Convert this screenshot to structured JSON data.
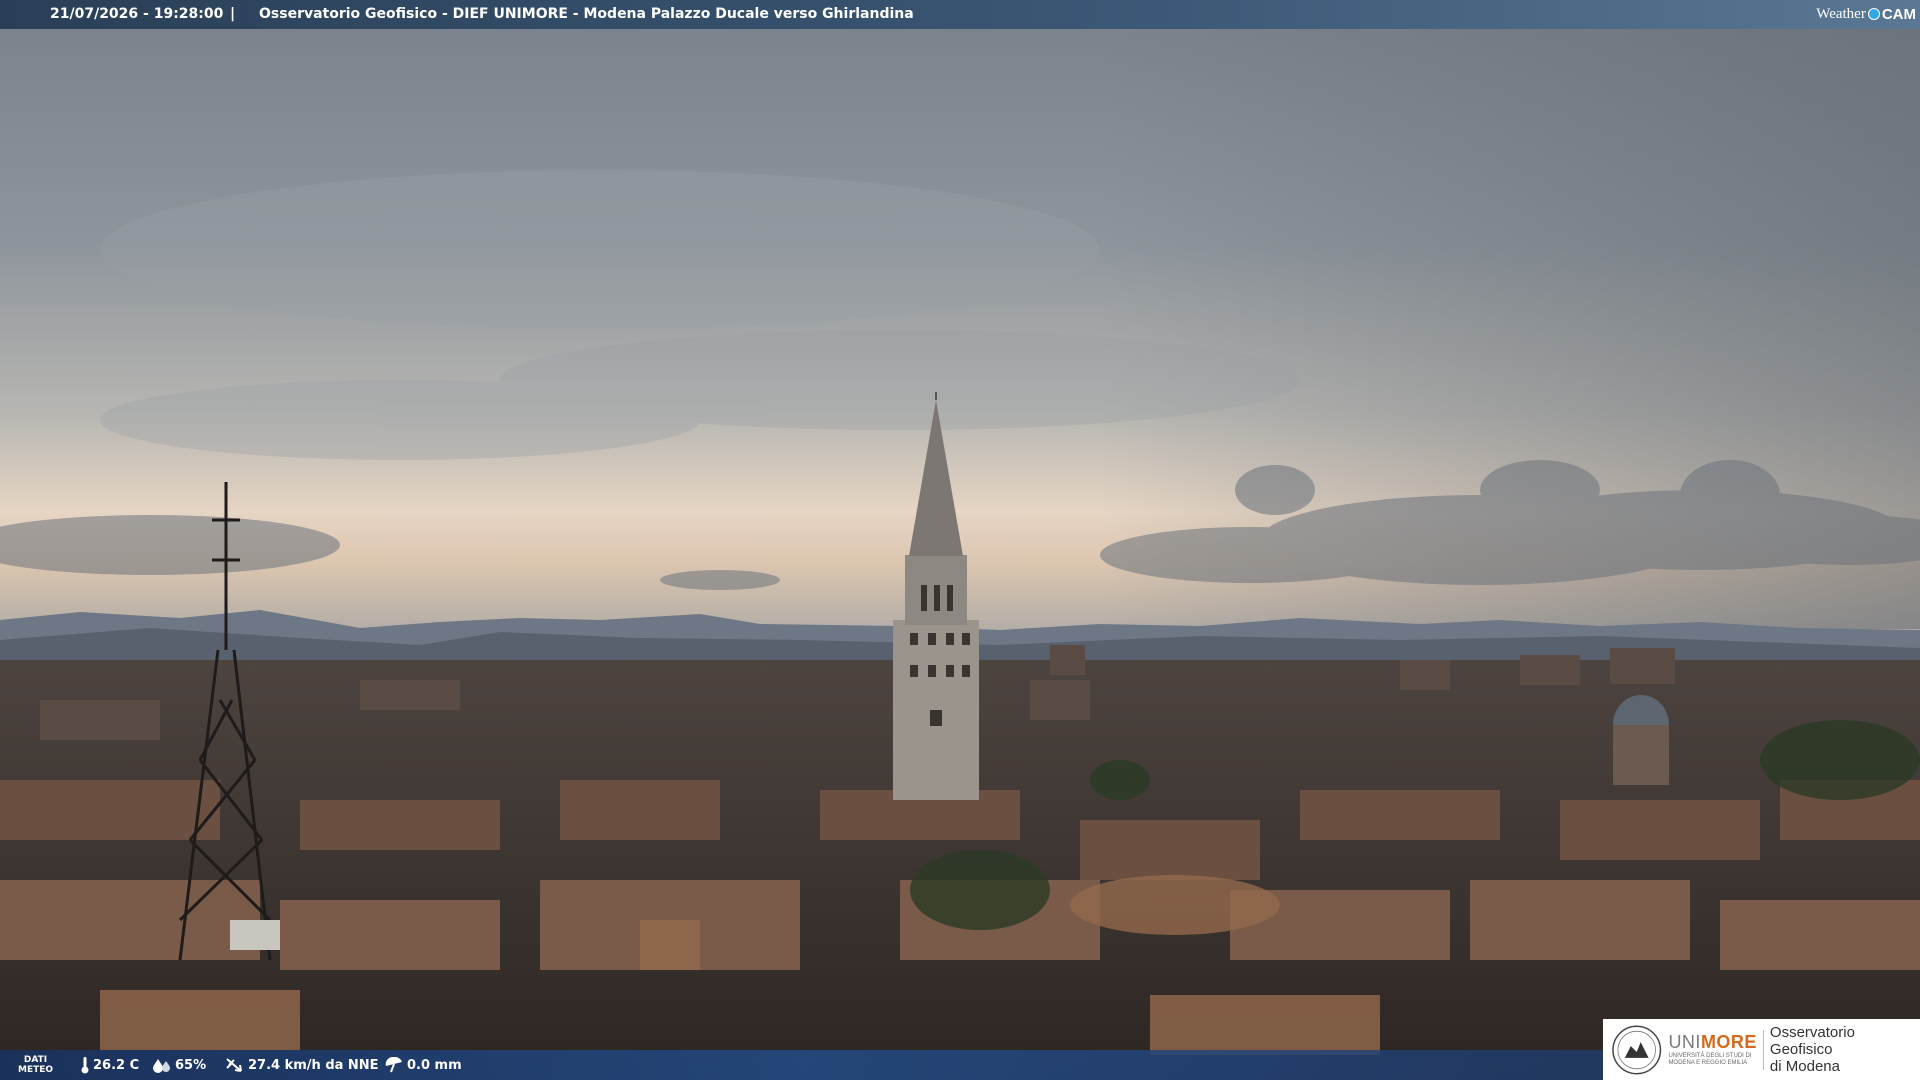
{
  "header": {
    "timestamp": "21/07/2026 - 19:28:00",
    "separator": "|",
    "title": "Osservatorio Geofisico - DIEF UNIMORE - Modena Palazzo Ducale verso Ghirlandina",
    "logo_text_a": "Weather",
    "logo_text_b": "CAM"
  },
  "weather_bar": {
    "label_line1": "DATI",
    "label_line2": "METEO",
    "temperature": "26.2 C",
    "humidity": "65%",
    "wind": "27.4 km/h da NNE",
    "rain": "0.0 mm"
  },
  "logo_box": {
    "brand_a": "UNI",
    "brand_b": "MORE",
    "brand_sub1": "UNIVERSITÀ DEGLI STUDI DI",
    "brand_sub2": "MODENA E REGGIO EMILIA",
    "observatory_line1": "Osservatorio Geofisico",
    "observatory_line2": "di Modena"
  },
  "colors": {
    "sky_top": "#7f8791",
    "sky_horizon": "#e7d6c4",
    "header_bg": "#2f4a66",
    "weather_bar_bg": "#1f3f75",
    "brand_orange": "#d46a1c"
  }
}
